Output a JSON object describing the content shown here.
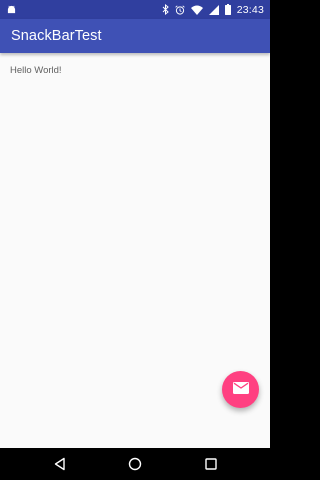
{
  "status_bar": {
    "time": "23:43",
    "icons": [
      "android-notification-icon",
      "bluetooth-icon",
      "alarm-icon",
      "wifi-icon",
      "cell-signal-icon",
      "battery-icon"
    ]
  },
  "app_bar": {
    "title": "SnackBarTest"
  },
  "content": {
    "message": "Hello World!"
  },
  "fab": {
    "icon": "email-icon",
    "color": "#ff4081"
  },
  "colors": {
    "primary": "#3f51b5",
    "primary_dark": "#303f9f",
    "accent": "#ff4081",
    "background": "#fafafa"
  },
  "nav_bar": {
    "buttons": [
      "back",
      "home",
      "recent-apps"
    ]
  }
}
